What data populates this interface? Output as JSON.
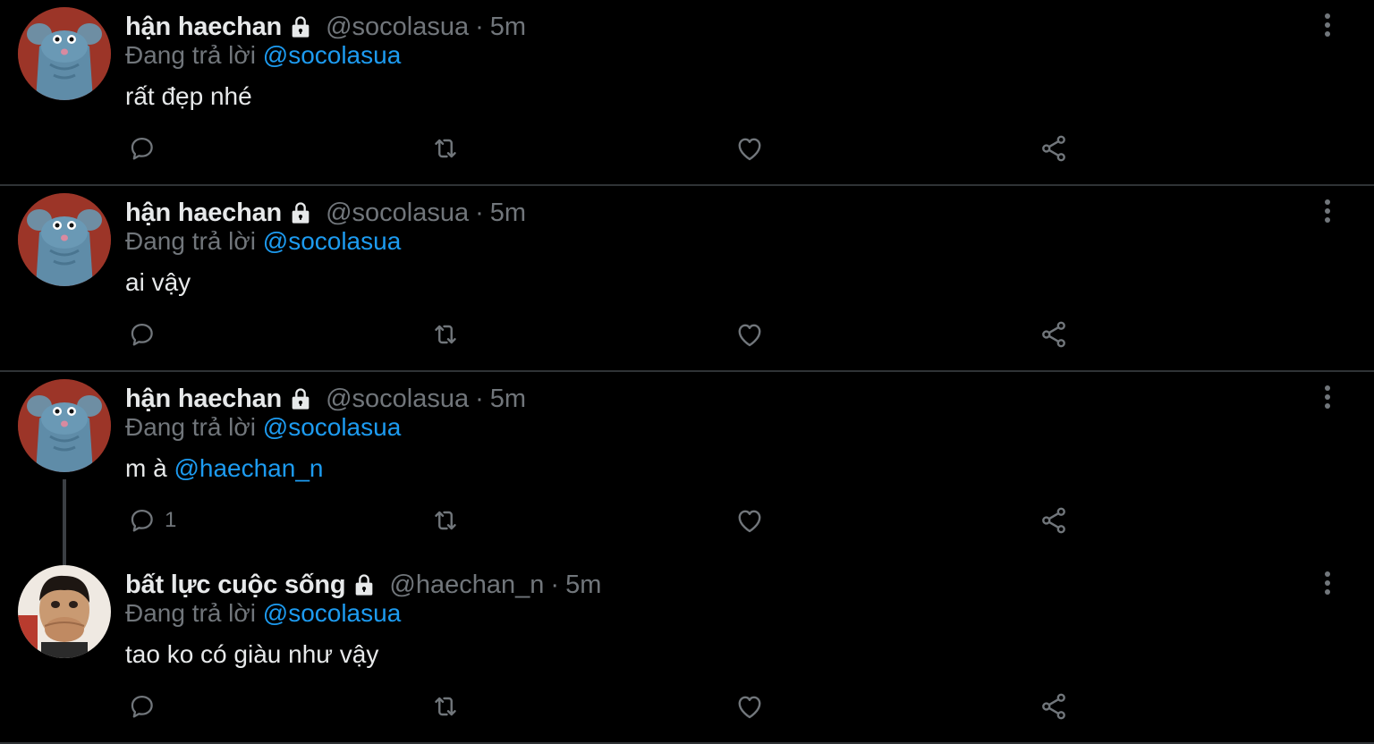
{
  "colors": {
    "background": "#000000",
    "text": "#e7e9ea",
    "muted": "#71767b",
    "link": "#1d9bf0",
    "divider": "#2f3336"
  },
  "tweets": [
    {
      "name": "hận haechan",
      "handle": "@socolasua",
      "sep": "·",
      "time": "5m",
      "replying_prefix": "Đang trả lời",
      "replying_to": "@socolasua",
      "text": "rất đẹp nhé",
      "text_mention": "",
      "reply_count": "",
      "avatar_icon": "blue-mouse-avatar"
    },
    {
      "name": "hận haechan",
      "handle": "@socolasua",
      "sep": "·",
      "time": "5m",
      "replying_prefix": "Đang trả lời",
      "replying_to": "@socolasua",
      "text": "ai vậy",
      "text_mention": "",
      "reply_count": "",
      "avatar_icon": "blue-mouse-avatar"
    },
    {
      "name": "hận haechan",
      "handle": "@socolasua",
      "sep": "·",
      "time": "5m",
      "replying_prefix": "Đang trả lời",
      "replying_to": "@socolasua",
      "text": "m à ",
      "text_mention": "@haechan_n",
      "reply_count": "1",
      "avatar_icon": "blue-mouse-avatar"
    },
    {
      "name": "bất lực cuộc sống",
      "handle": "@haechan_n",
      "sep": "·",
      "time": "5m",
      "replying_prefix": "Đang trả lời",
      "replying_to": "@socolasua",
      "text": "tao ko có giàu như vậy",
      "text_mention": "",
      "reply_count": "",
      "avatar_icon": "person-photo-avatar"
    }
  ],
  "icons": [
    "lock-icon",
    "more-icon",
    "reply-icon",
    "retweet-icon",
    "like-icon",
    "share-icon"
  ]
}
